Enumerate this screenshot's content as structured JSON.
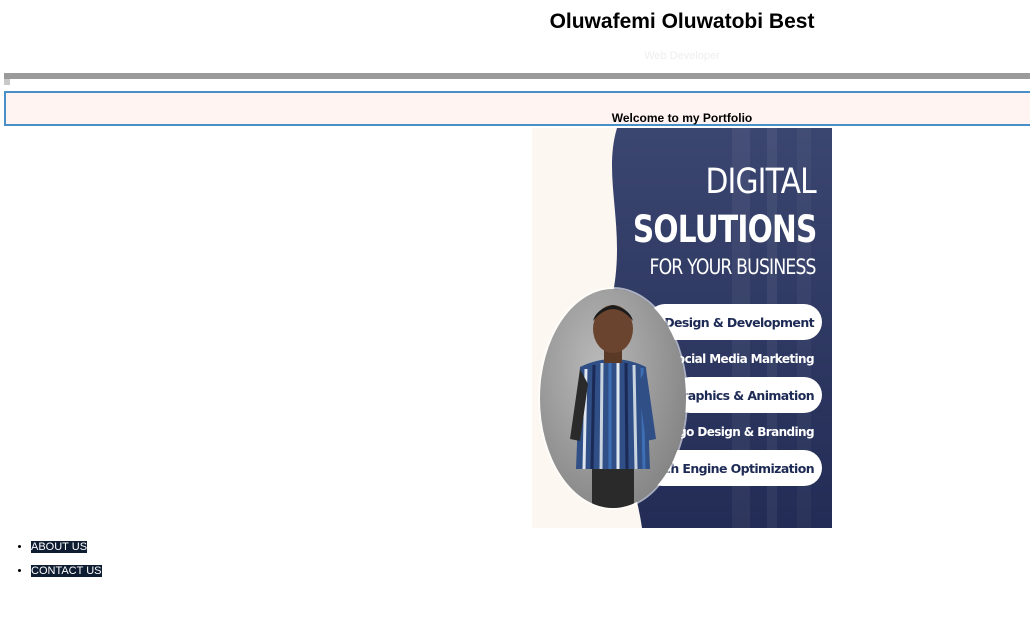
{
  "header": {
    "title": "Oluwafemi Oluwatobi Best",
    "subtitle": "Web Developer"
  },
  "welcome": {
    "text": "Welcome to my Portfolio"
  },
  "banner": {
    "line1": "DIGITAL",
    "line2": "SOLUTIONS",
    "line3": "FOR YOUR BUSINESS",
    "services": [
      "Web Design & Development",
      "Social Media Marketing",
      "Graphics & Animation",
      "Logo Design & Branding",
      "Search Engine Optimization"
    ],
    "colors": {
      "navy": "#2d3863",
      "cream": "#fdf7f1"
    }
  },
  "nav": {
    "items": [
      {
        "label": "ABOUT US"
      },
      {
        "label": "CONTACT US"
      }
    ]
  },
  "colors": {
    "welcome_bg": "#fff4f2",
    "welcome_border": "#4a90c8",
    "rule": "#9a9a9a",
    "nav_link_bg": "#0f1d33"
  }
}
